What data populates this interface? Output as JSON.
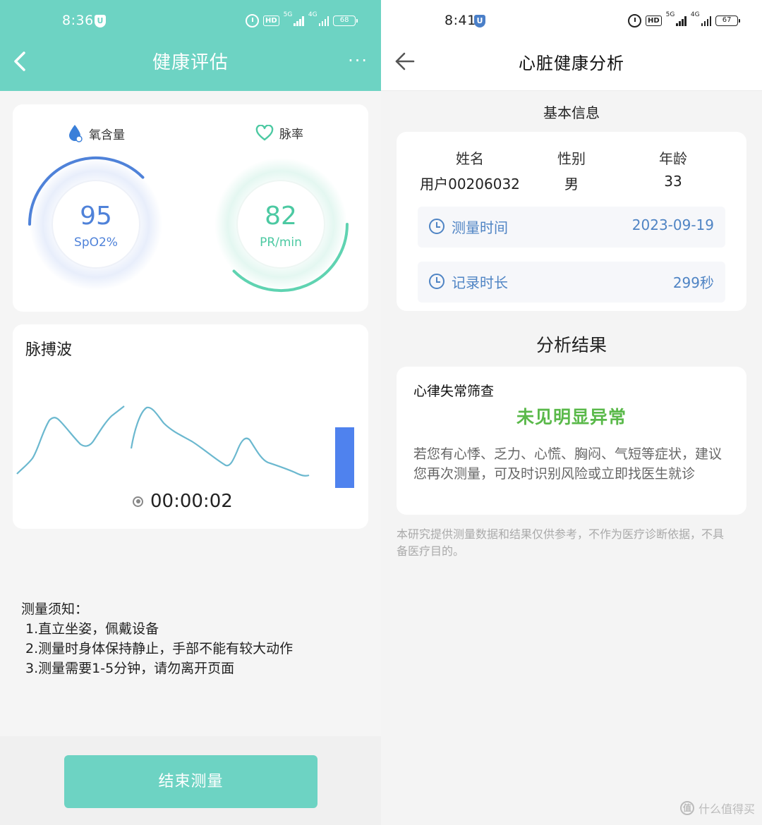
{
  "left": {
    "status": {
      "time": "8:36",
      "shield": "U",
      "hd": "HD",
      "sig1": "5G",
      "sig2": "4G",
      "battery": "68"
    },
    "header": {
      "title": "健康评估",
      "back_icon": "chevron-left-icon",
      "more": "···"
    },
    "spo2": {
      "label": "氧含量",
      "value": "95",
      "unit": "SpO2%",
      "icon": "drop-icon",
      "color": "#4f82d9",
      "level": 0.75
    },
    "pulse": {
      "label": "脉率",
      "value": "82",
      "unit": "PR/min",
      "icon": "heart-icon",
      "color": "#5fd3b1",
      "level": 0.75
    },
    "wave": {
      "title": "脉搏波",
      "timer": "00:00:02",
      "color": "#6bb8cf",
      "bar_color": "#4f82ee"
    },
    "notes": {
      "title": "测量须知：",
      "lines": [
        "1.直立坐姿，佩戴设备",
        "2.测量时身体保持静止，手部不能有较大动作",
        "3.测量需要1-5分钟，请勿离开页面"
      ]
    },
    "end_button": "结束测量"
  },
  "right": {
    "status": {
      "time": "8:41",
      "shield": "U",
      "hd": "HD",
      "sig1": "5G",
      "sig2": "4G",
      "battery": "67"
    },
    "header": {
      "title": "心脏健康分析",
      "back_icon": "arrow-left-icon"
    },
    "basic": {
      "section_title": "基本信息",
      "headers": [
        "姓名",
        "性别",
        "年龄"
      ],
      "values": [
        "用户00206032",
        "男",
        "33"
      ],
      "rows": [
        {
          "label": "测量时间",
          "value": "2023-09-19"
        },
        {
          "label": "记录时长",
          "value": "299秒"
        }
      ]
    },
    "analysis": {
      "section_title": "分析结果",
      "subtitle": "心律失常筛查",
      "result": "未见明显异常",
      "desc": "若您有心悸、乏力、心慌、胸闷、气短等症状，建议您再次测量，可及时识别风险或立即找医生就诊"
    },
    "disclaimer": "本研究提供测量数据和结果仅供参考，不作为医疗诊断依据，不具备医疗目的。",
    "watermark": "什么值得买"
  }
}
